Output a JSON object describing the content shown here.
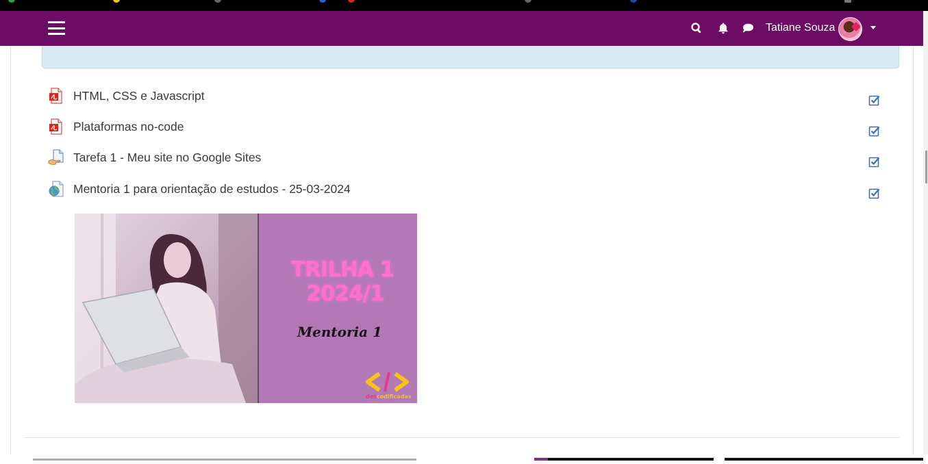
{
  "header": {
    "user_name": "Tatiane Souza",
    "nav_color": "#6d0c64"
  },
  "activities": [
    {
      "label": "HTML, CSS e Javascript",
      "icon": "pdf-icon",
      "completed": true
    },
    {
      "label": "Plataformas no-code",
      "icon": "pdf-icon",
      "completed": true
    },
    {
      "label": "Tarefa 1 - Meu site no Google Sites",
      "icon": "assignment-icon",
      "completed": true
    },
    {
      "label": "Mentoria 1 para orientação de estudos - 25-03-2024",
      "icon": "url-globe-icon",
      "completed": true
    }
  ],
  "banner": {
    "title_line1": "TRILHA 1",
    "title_line2": "2024/1",
    "subtitle": "Mentoria 1",
    "logo_text_a": "des",
    "logo_text_b": "codificadas",
    "accent_pink": "#ff5fc2",
    "panel_color": "#b379b6"
  }
}
